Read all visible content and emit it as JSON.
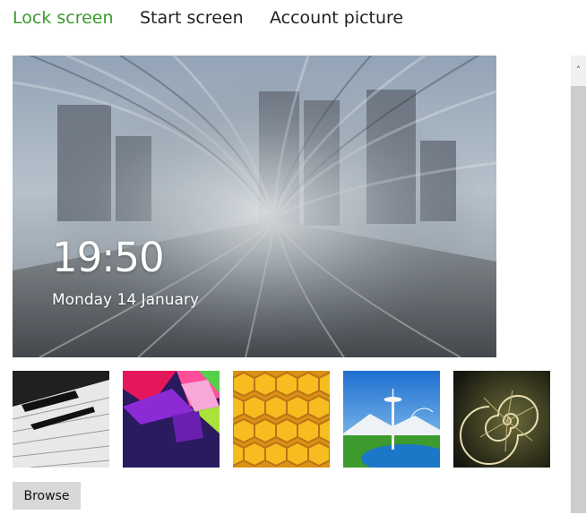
{
  "tabs": [
    {
      "label": "Lock screen",
      "active": true
    },
    {
      "label": "Start screen",
      "active": false
    },
    {
      "label": "Account picture",
      "active": false
    }
  ],
  "preview": {
    "time": "19:50",
    "date": "Monday 14 January"
  },
  "thumbnails": [
    {
      "subject": "piano keys"
    },
    {
      "subject": "colorful geometric shapes"
    },
    {
      "subject": "honeycomb"
    },
    {
      "subject": "space needle"
    },
    {
      "subject": "nautilus shell"
    }
  ],
  "browse_label": "Browse",
  "colors": {
    "active_tab": "#3a9a2c",
    "inactive_tab": "#222222",
    "button_bg": "#d8d8d8",
    "scrollbar_thumb": "#cdcdcd"
  },
  "icons": {
    "scroll_up": "chevron-up-icon"
  }
}
